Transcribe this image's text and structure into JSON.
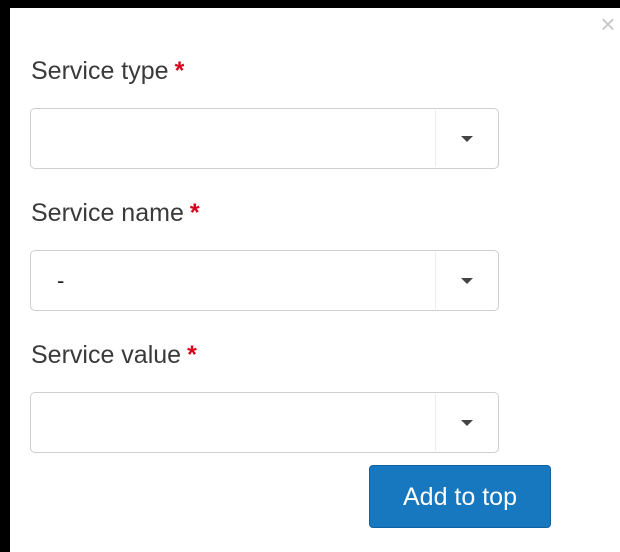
{
  "dialog": {
    "close_glyph": "×",
    "fields": [
      {
        "label": "Service type",
        "required_mark": "*",
        "value": ""
      },
      {
        "label": "Service name",
        "required_mark": "*",
        "value": "-"
      },
      {
        "label": "Service value",
        "required_mark": "*",
        "value": ""
      }
    ],
    "add_button_label": "Add to top"
  },
  "colors": {
    "required": "#d9001b",
    "button": "#1777bf",
    "border": "#cfcfcf"
  },
  "icons": {
    "close": "close-icon",
    "dropdown": "chevron-down-icon"
  }
}
